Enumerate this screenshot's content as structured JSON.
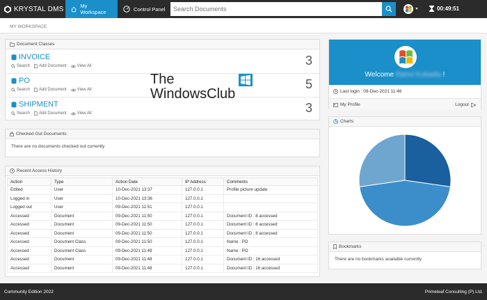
{
  "topbar": {
    "brand": "KRYSTAL DMS",
    "nav_workspace": "My Workspace",
    "nav_control": "Control Panel",
    "search_placeholder": "Search Documents",
    "timer": "00:49:51"
  },
  "breadcrumb": "MY WORKSPACE",
  "doc_classes": {
    "title": "Document Classes",
    "action_search": "Search",
    "action_add": "Add Document",
    "action_view": "View All",
    "items": [
      {
        "name": "INVOICE",
        "count": "3"
      },
      {
        "name": "PO",
        "count": "5"
      },
      {
        "name": "SHIPMENT",
        "count": "3"
      }
    ]
  },
  "checked_out": {
    "title": "Checked Out Documents",
    "empty": "There are no documents checked out currently"
  },
  "history": {
    "title": "Recent Access History",
    "columns": [
      "Action",
      "Type",
      "Action Date",
      "IP Address",
      "Comments"
    ],
    "rows": [
      [
        "Edited",
        "User",
        "10-Dec-2021 13:37",
        "127.0.0.1",
        "Profile picture update"
      ],
      [
        "Logged in",
        "User",
        "10-Dec-2021 13:36",
        "127.0.0.1",
        ""
      ],
      [
        "Logged out",
        "User",
        "09-Dec-2021 11:51",
        "127.0.0.1",
        ""
      ],
      [
        "Accessed",
        "Document",
        "09-Dec-2021 11:50",
        "127.0.0.1",
        "Document ID : 8 accessed"
      ],
      [
        "Accessed",
        "Document",
        "09-Dec-2021 11:50",
        "127.0.0.1",
        "Document ID : 8 accessed"
      ],
      [
        "Accessed",
        "Document",
        "09-Dec-2021 11:50",
        "127.0.0.1",
        "Document ID : 8 accessed"
      ],
      [
        "Accessed",
        "Document Class",
        "09-Dec-2021 11:50",
        "127.0.0.1",
        "Name : PO"
      ],
      [
        "Accessed",
        "Document Class",
        "09-Dec-2021 11:49",
        "127.0.0.1",
        "Name : PO"
      ],
      [
        "Accessed",
        "Document",
        "09-Dec-2021 11:48",
        "127.0.0.1",
        "Document ID : 16 accessed"
      ],
      [
        "Accessed",
        "Document",
        "09-Dec-2021 11:48",
        "127.0.0.1",
        "Document ID : 16 accessed"
      ]
    ]
  },
  "profile": {
    "welcome": "Welcome",
    "user_name": "Rahul Kukadia",
    "exclaim": "!",
    "last_login": "Last login : 09-Dec-2021 11:46",
    "my_profile": "My Profile",
    "logout": "Logout"
  },
  "charts": {
    "title": "Charts",
    "colors": [
      "#1a5f9e",
      "#3b8ec9",
      "#6fa6d0"
    ]
  },
  "chart_data": {
    "type": "pie",
    "values": [
      3,
      5,
      3
    ],
    "title": ""
  },
  "bookmarks": {
    "title": "Bookmarks",
    "empty": "There are no bookmarks available currently"
  },
  "footer": {
    "left": "Community Edition 2022",
    "right": "Primeleaf Consulting (P) Ltd."
  },
  "watermark": {
    "line1": "The",
    "line2": "WindowsClub"
  }
}
